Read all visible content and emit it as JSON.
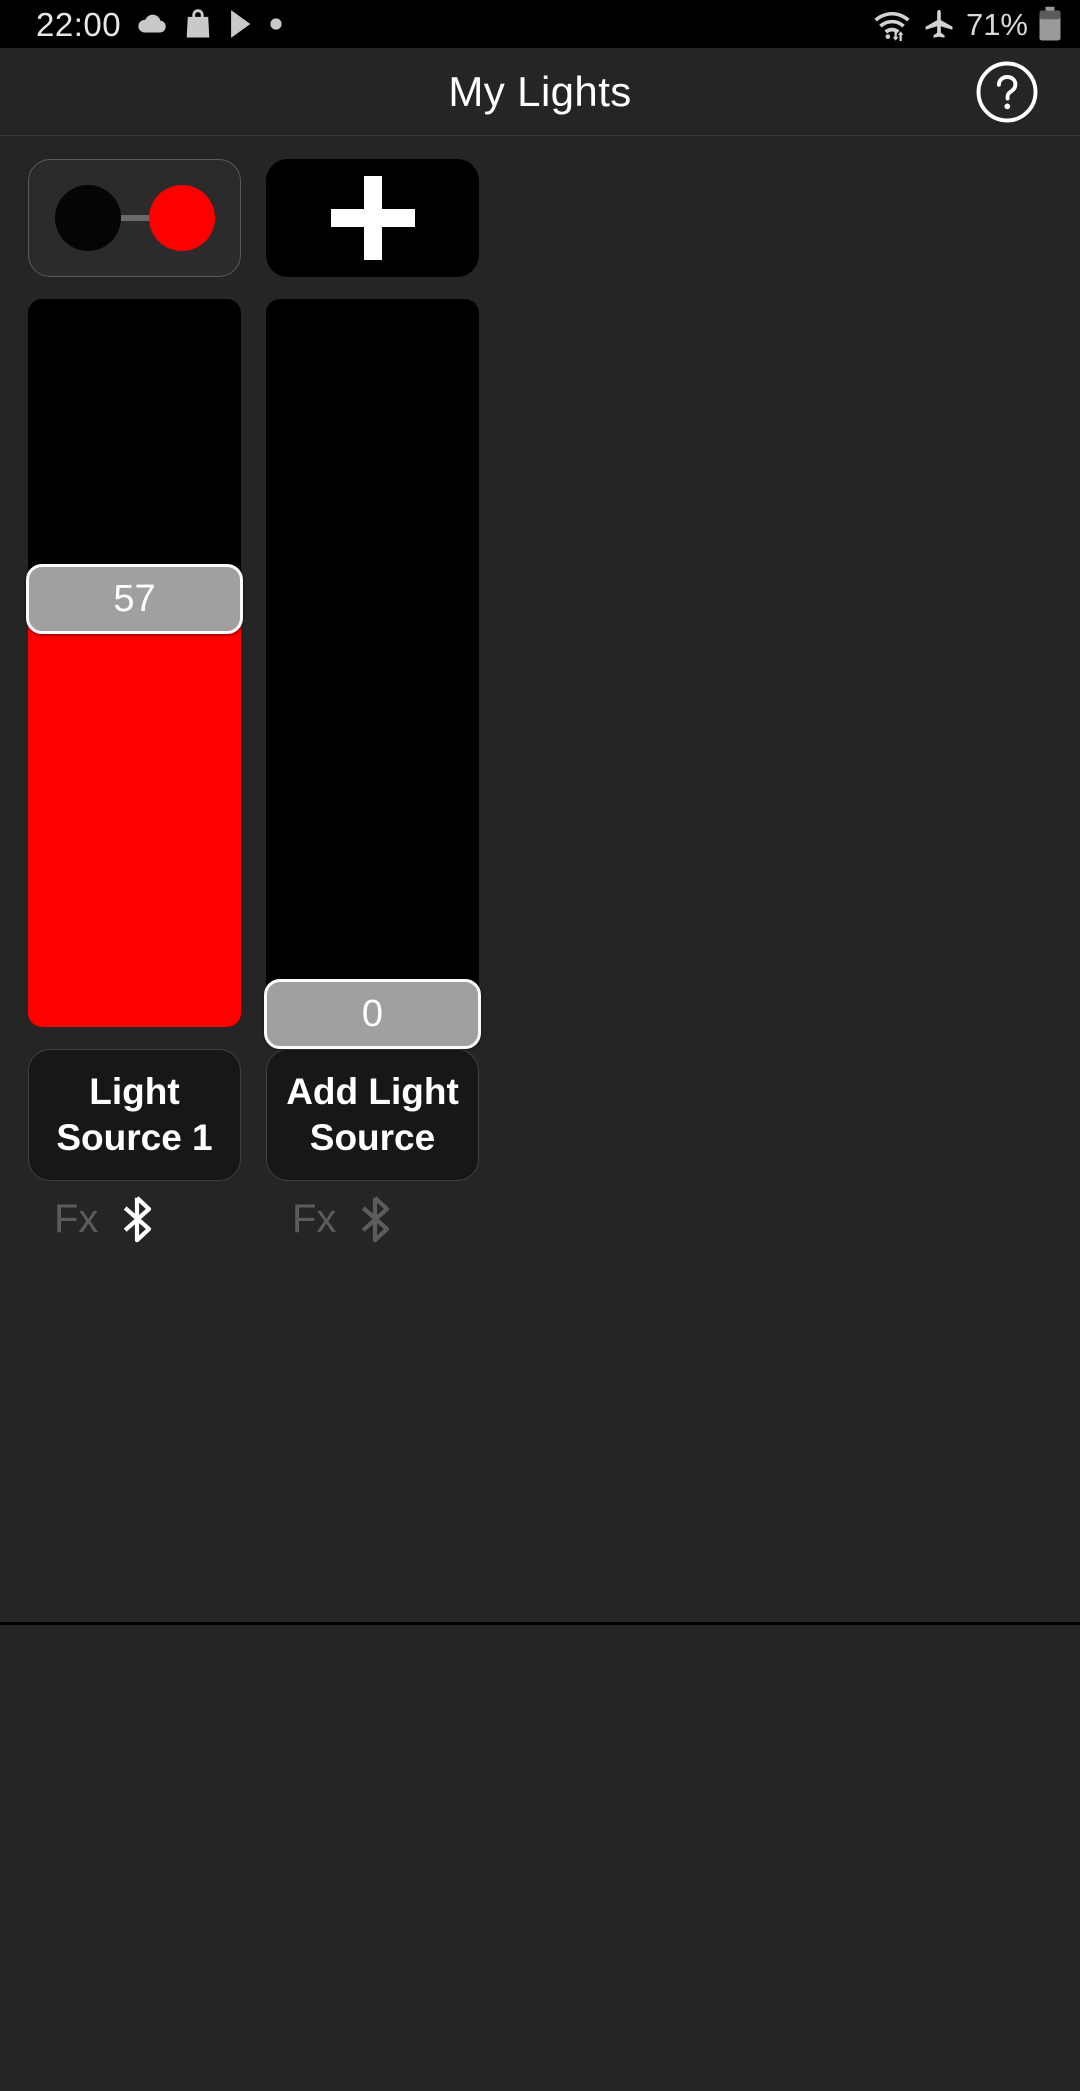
{
  "statusbar": {
    "time": "22:00",
    "battery_percent": "71%",
    "left_icons": [
      "cloud-icon",
      "shopping-bag-icon",
      "play-store-icon",
      "dot-icon"
    ],
    "right_icons": [
      "wifi-icon",
      "airplane-mode-icon",
      "battery-icon"
    ]
  },
  "header": {
    "title": "My Lights",
    "help_icon": "help-circle-icon"
  },
  "colors": {
    "accent_red": "#ff0000",
    "background": "#252525",
    "track": "#000000",
    "thumb": "#a0a0a0"
  },
  "light_sources": [
    {
      "control_type": "toggle",
      "toggle_off_label": "off-dot",
      "toggle_on_label": "on-dot",
      "toggle_state": "on",
      "slider_value": "57",
      "slider_percent": 57,
      "name_label": "Light Source 1",
      "fx_label": "Fx",
      "fx_enabled": false,
      "bluetooth_icon": "bluetooth-icon",
      "bluetooth_connected": true
    },
    {
      "control_type": "add",
      "add_icon": "plus-icon",
      "slider_value": "0",
      "slider_percent": 0,
      "name_label": "Add Light Source",
      "fx_label": "Fx",
      "fx_enabled": false,
      "bluetooth_icon": "bluetooth-icon",
      "bluetooth_connected": false
    }
  ]
}
